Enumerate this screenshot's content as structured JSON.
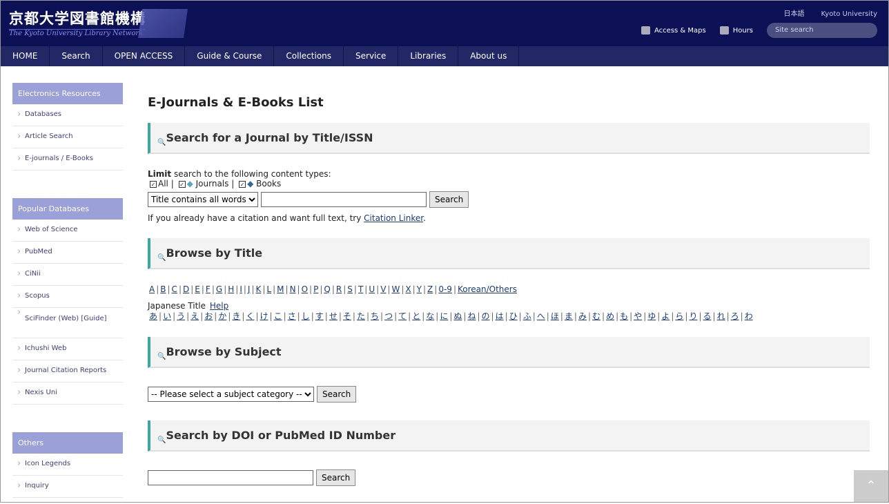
{
  "header": {
    "logo_jp": "京都大学図書館機構",
    "logo_en": "The Kyoto University Library Network",
    "lang": "日本語",
    "univ": "Kyoto University",
    "access": "Access & Maps",
    "hours": "Hours",
    "search_placeholder": "Site search"
  },
  "nav": [
    "HOME",
    "Search",
    "OPEN ACCESS",
    "Guide & Course",
    "Collections",
    "Service",
    "Libraries",
    "About us"
  ],
  "sidebar": [
    {
      "title": "Electronics Resources",
      "items": [
        "Databases",
        "Article Search",
        "E-journals / E-Books"
      ]
    },
    {
      "title": "Popular Databases",
      "items": [
        "Web of Science",
        "PubMed",
        "CiNii",
        "Scopus",
        "SciFinder (Web) [Guide]",
        "Ichushi Web",
        "Journal Citation Reports",
        "Nexis Uni"
      ]
    },
    {
      "title": "Others",
      "items": [
        "Icon Legends",
        "Inquiry"
      ]
    }
  ],
  "main": {
    "title": "E-Journals & E-Books List",
    "s1": {
      "title": "Search for a Journal by Title/ISSN",
      "limit_bold": "Limit",
      "limit_rest": " search to the following content types:",
      "all": "All",
      "journals": "Journals",
      "books": "Books",
      "select": "Title contains all words",
      "search": "Search",
      "cit_pre": "If you already have a citation and want full text, try ",
      "cit_link": "Citation Linker",
      "cit_post": "."
    },
    "s2": {
      "title": "Browse by Title",
      "letters": [
        "A",
        "B",
        "C",
        "D",
        "E",
        "F",
        "G",
        "H",
        "I",
        "J",
        "K",
        "L",
        "M",
        "N",
        "O",
        "P",
        "Q",
        "R",
        "S",
        "T",
        "U",
        "V",
        "W",
        "X",
        "Y",
        "Z",
        "0-9",
        "Korean/Others"
      ],
      "jp_label": "Japanese Title ",
      "help": "Help",
      "kana": [
        "あ",
        "い",
        "う",
        "え",
        "お",
        "か",
        "き",
        "く",
        "け",
        "こ",
        "さ",
        "し",
        "す",
        "せ",
        "そ",
        "た",
        "ち",
        "つ",
        "て",
        "と",
        "な",
        "に",
        "ぬ",
        "ね",
        "の",
        "は",
        "ひ",
        "ふ",
        "へ",
        "ほ",
        "ま",
        "み",
        "む",
        "め",
        "も",
        "や",
        "ゆ",
        "よ",
        "ら",
        "り",
        "る",
        "れ",
        "ろ",
        "わ"
      ]
    },
    "s3": {
      "title": "Browse by Subject",
      "select": "-- Please select a subject category --",
      "search": "Search"
    },
    "s4": {
      "title": "Search by DOI or PubMed ID Number",
      "search": "Search"
    }
  },
  "scroll_top": "⌃",
  "colors": {
    "header": "#0c1155",
    "nav": "#222766",
    "sidebar_head": "#9aa0d8",
    "accent": "#3fa7a3"
  }
}
